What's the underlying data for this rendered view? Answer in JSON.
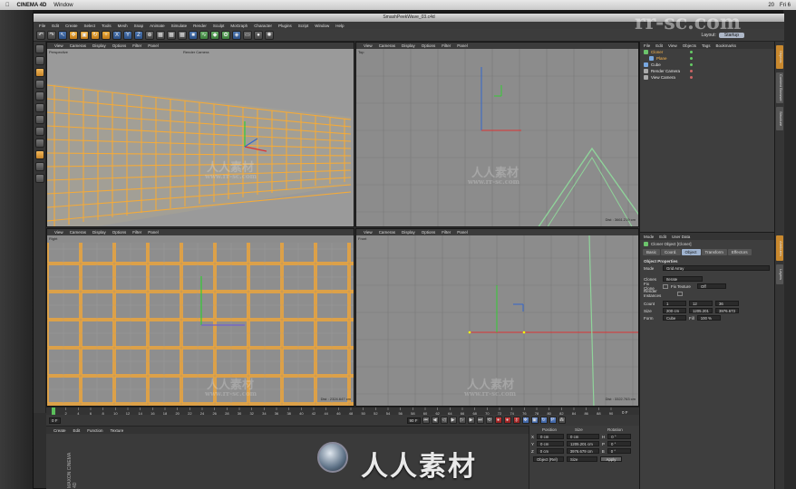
{
  "mac_menubar": {
    "apple": "",
    "app": "CINEMA 4D",
    "items": [
      "Window"
    ],
    "right_status": [
      "20",
      "Fri 6"
    ]
  },
  "window": {
    "title": "SmashPeekWave_03.c4d"
  },
  "menubar": {
    "items": [
      "File",
      "Edit",
      "Create",
      "Select",
      "Tools",
      "Mesh",
      "Snap",
      "Animate",
      "Simulate",
      "Render",
      "Sculpt",
      "MoGraph",
      "Character",
      "Plugins",
      "Script",
      "Window",
      "Help"
    ]
  },
  "toolbar": {
    "layout_label": "Layout:",
    "layout_value": "Startup"
  },
  "viewports": [
    {
      "id": "perspective",
      "menu": [
        "View",
        "Cameras",
        "Display",
        "Options",
        "Filter",
        "Panel"
      ],
      "label": "Perspective",
      "camera_label": "Render Camera",
      "info": ""
    },
    {
      "id": "top",
      "menu": [
        "View",
        "Cameras",
        "Display",
        "Options",
        "Filter",
        "Panel"
      ],
      "label": "Top",
      "info": "Dist : 3661.219 cm"
    },
    {
      "id": "right",
      "menu": [
        "View",
        "Cameras",
        "Display",
        "Options",
        "Filter",
        "Panel"
      ],
      "label": "Right",
      "info": "Dist : 2324.647 cm"
    },
    {
      "id": "front",
      "menu": [
        "View",
        "Cameras",
        "Display",
        "Options",
        "Filter",
        "Panel"
      ],
      "label": "Front",
      "info": "Dist : 3322.763 cm"
    }
  ],
  "timeline": {
    "ticks": [
      "0",
      "2",
      "4",
      "6",
      "8",
      "10",
      "12",
      "14",
      "16",
      "18",
      "20",
      "22",
      "24",
      "26",
      "28",
      "30",
      "32",
      "34",
      "36",
      "38",
      "40",
      "42",
      "44",
      "46",
      "48",
      "50",
      "52",
      "54",
      "56",
      "58",
      "60",
      "62",
      "64",
      "66",
      "68",
      "70",
      "72",
      "74",
      "76",
      "78",
      "80",
      "82",
      "84",
      "86",
      "88",
      "90"
    ],
    "end_label": "0 F",
    "start_field": "0 F",
    "end_field": "90 F"
  },
  "material_manager": {
    "menu": [
      "Create",
      "Edit",
      "Function",
      "Texture"
    ]
  },
  "coordinates": {
    "headers": [
      "Position",
      "Size",
      "Rotation"
    ],
    "rows": [
      {
        "axis": "X",
        "pos": "0 cm",
        "size": "0 cm",
        "rot_axis": "H",
        "rot": "0 °"
      },
      {
        "axis": "Y",
        "pos": "0 cm",
        "size": "1205.201 cm",
        "rot_axis": "P",
        "rot": "0 °"
      },
      {
        "axis": "Z",
        "pos": "0 cm",
        "size": "3976.679 cm",
        "rot_axis": "B",
        "rot": "0 °"
      }
    ],
    "mode_select": "Object (Rel)",
    "size_select": "Size",
    "apply_label": "Apply"
  },
  "object_manager": {
    "menu": [
      "File",
      "Edit",
      "View",
      "Objects",
      "Tags",
      "Bookmarks"
    ],
    "objects": [
      {
        "name": "Cloner",
        "indent": 0,
        "selected": true
      },
      {
        "name": "Plane",
        "indent": 1,
        "selected": true
      },
      {
        "name": "Cube",
        "indent": 0,
        "selected": false
      },
      {
        "name": "Render Camera",
        "indent": 0,
        "selected": false
      },
      {
        "name": "View Camera",
        "indent": 0,
        "selected": false
      }
    ]
  },
  "attribute_manager": {
    "menu": [
      "Mode",
      "Edit",
      "User Data"
    ],
    "object_title": "Cloner Object [Cloner]",
    "tabs": [
      "Basic",
      "Coord.",
      "Object",
      "Transform",
      "Effectors"
    ],
    "active_tab": "Object",
    "section": "Object Properties",
    "mode_label": "Mode",
    "mode_value": "Grid Array",
    "clones_label": "Clones",
    "clones_value": "Iterate",
    "fix_clone_label": "Fix Clone",
    "fix_texture_label": "Fix Texture",
    "fix_texture_value": "Off",
    "render_instances_label": "Render Instances",
    "count_label": "Count",
    "count_values": [
      "1",
      "12",
      "36"
    ],
    "size_label": "Size",
    "size_values": [
      "200 cm",
      "1205.201",
      "3976.673"
    ],
    "form_label": "Form",
    "form_value": "Cube",
    "fill_label": "Fill",
    "fill_value": "100 %"
  },
  "side_tabs": [
    "Objects",
    "Content Browser",
    "Structure",
    "Attributes",
    "Layers"
  ],
  "watermark": {
    "cn": "人人素材",
    "url": "www.rr-sc.com",
    "brand": "rr-sc.com"
  },
  "maxon_label": "MAXON CINEMA 4D"
}
